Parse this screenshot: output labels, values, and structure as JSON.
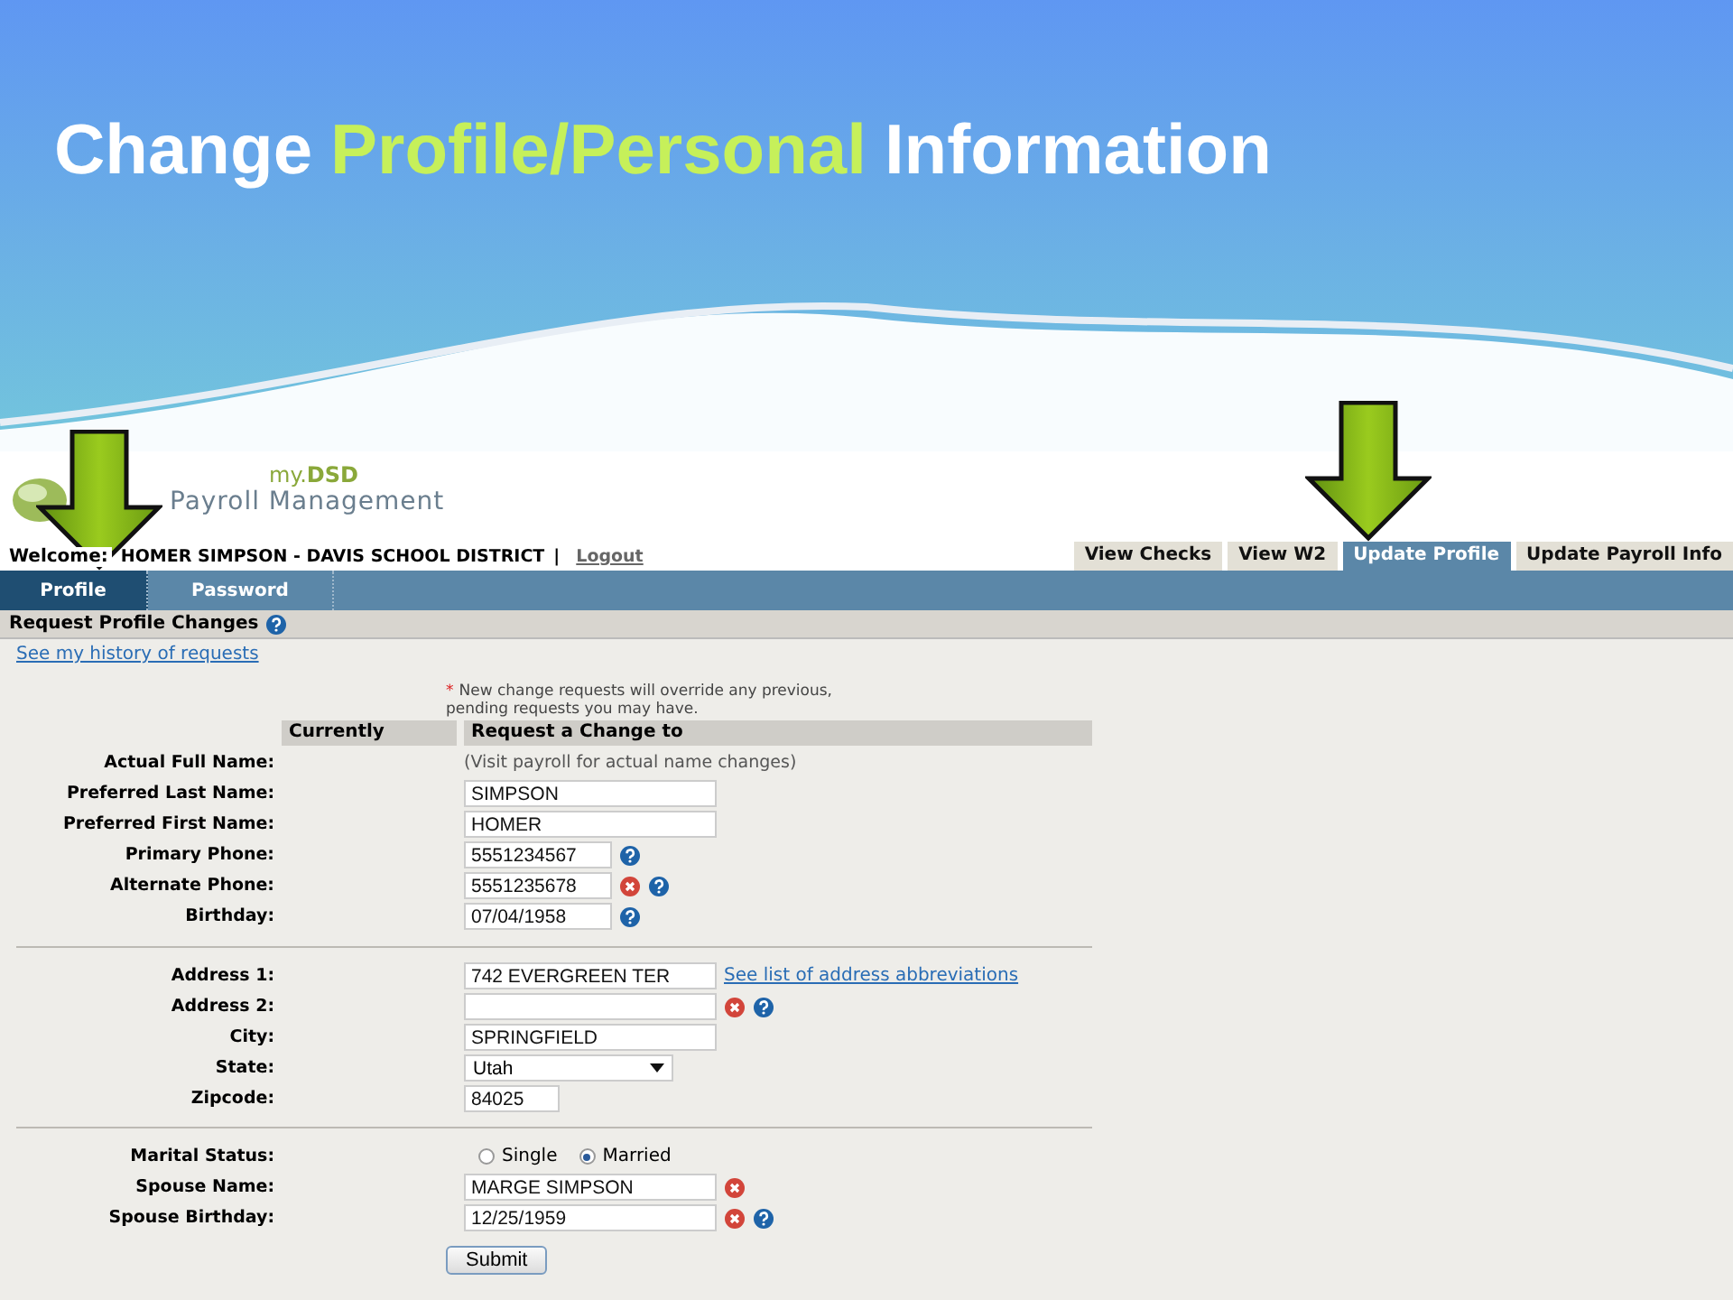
{
  "slide_title": [
    {
      "text": "Change",
      "highlight": false
    },
    {
      "text": "Profile/Personal",
      "highlight": true
    },
    {
      "text": "Information",
      "highlight": false
    }
  ],
  "logo": {
    "top": "my.",
    "accent": "DSD",
    "bottom": "Payroll Management"
  },
  "welcome": {
    "label": "Welcome:",
    "user": "HOMER SIMPSON - DAVIS SCHOOL DISTRICT",
    "separator": "|",
    "logout": "Logout"
  },
  "main_tabs": [
    {
      "label": "View Checks",
      "selected": false
    },
    {
      "label": "View W2",
      "selected": false
    },
    {
      "label": "Update Profile",
      "selected": true
    },
    {
      "label": "Update Payroll Info",
      "selected": false
    }
  ],
  "sub_tabs": [
    {
      "label": "Profile",
      "selected": true
    },
    {
      "label": "Password",
      "selected": false
    }
  ],
  "section": {
    "title": "Request Profile Changes",
    "history_link": "See my history of requests"
  },
  "notice": {
    "mark": "*",
    "text": "New change requests will override any previous, pending requests you may have."
  },
  "columns": [
    "Currently",
    "Request a Change to"
  ],
  "sections": [
    [
      {
        "kind": "note",
        "label": "Actual Full Name:",
        "value": "(Visit payroll for actual name changes)"
      },
      {
        "kind": "text",
        "label": "Preferred Last Name:",
        "value": "SIMPSON"
      },
      {
        "kind": "text",
        "label": "Preferred First Name:",
        "value": "HOMER"
      },
      {
        "kind": "short",
        "label": "Primary Phone:",
        "value": "5551234567",
        "help": true
      },
      {
        "kind": "short",
        "label": "Alternate Phone:",
        "value": "5551235678",
        "clear": true,
        "help": true
      },
      {
        "kind": "short",
        "label": "Birthday:",
        "value": "07/04/1958",
        "help": true
      }
    ],
    [
      {
        "kind": "text",
        "label": "Address 1:",
        "value": "742 EVERGREEN TER",
        "link": "See list of address abbreviations"
      },
      {
        "kind": "text",
        "label": "Address 2:",
        "clear": true,
        "help": true
      },
      {
        "kind": "text",
        "label": "City:",
        "value": "SPRINGFIELD"
      },
      {
        "kind": "select",
        "label": "State:",
        "value": "Utah"
      },
      {
        "kind": "tiny",
        "label": "Zipcode:",
        "value": "84025"
      }
    ],
    [
      {
        "kind": "radio",
        "label": "Marital Status:",
        "options": [
          {
            "label": "Single",
            "selected": false
          },
          {
            "label": "Married",
            "selected": true
          }
        ]
      },
      {
        "kind": "text",
        "label": "Spouse Name:",
        "value": "MARGE SIMPSON",
        "clear": true
      },
      {
        "kind": "text",
        "label": "Spouse Birthday:",
        "value": "12/25/1959",
        "clear": true,
        "help": true
      }
    ]
  ],
  "submit": "Submit"
}
